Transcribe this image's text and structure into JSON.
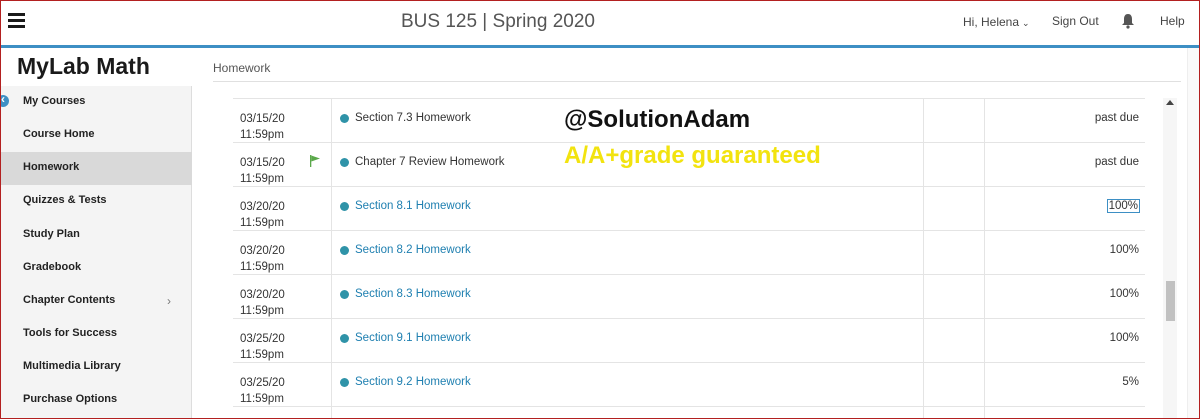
{
  "header": {
    "course_title": "BUS 125 | Spring 2020",
    "greeting": "Hi, Helena",
    "sign_out": "Sign Out",
    "help": "Help"
  },
  "sidebar": {
    "brand": "MyLab Math",
    "items": [
      {
        "label": "My Courses"
      },
      {
        "label": "Course Home"
      },
      {
        "label": "Homework"
      },
      {
        "label": "Quizzes & Tests"
      },
      {
        "label": "Study Plan"
      },
      {
        "label": "Gradebook"
      },
      {
        "label": "Chapter Contents"
      },
      {
        "label": "Tools for Success"
      },
      {
        "label": "Multimedia Library"
      },
      {
        "label": "Purchase Options"
      }
    ]
  },
  "breadcrumb": "Homework",
  "rows": [
    {
      "date": "03/15/20",
      "time": "11:59pm",
      "title": "Section 7.3 Homework",
      "score": "past due"
    },
    {
      "date": "03/15/20",
      "time": "11:59pm",
      "title": "Chapter 7 Review Homework",
      "score": "past due"
    },
    {
      "date": "03/20/20",
      "time": "11:59pm",
      "title": "Section 8.1 Homework",
      "score": "100%"
    },
    {
      "date": "03/20/20",
      "time": "11:59pm",
      "title": "Section 8.2 Homework",
      "score": "100%"
    },
    {
      "date": "03/20/20",
      "time": "11:59pm",
      "title": "Section 8.3 Homework",
      "score": "100%"
    },
    {
      "date": "03/25/20",
      "time": "11:59pm",
      "title": "Section 9.1 Homework",
      "score": "100%"
    },
    {
      "date": "03/25/20",
      "time": "11:59pm",
      "title": "Section 9.2 Homework",
      "score": "5%"
    }
  ],
  "watermark": {
    "handle": "@SolutionAdam",
    "promo": "A/A+grade guaranteed"
  },
  "colors": {
    "accent": "#3d8fc4",
    "link": "#1e7fb0",
    "status_dot": "#2f93a8",
    "flag": "#5aa84a",
    "promo_text": "#f2e30f"
  }
}
